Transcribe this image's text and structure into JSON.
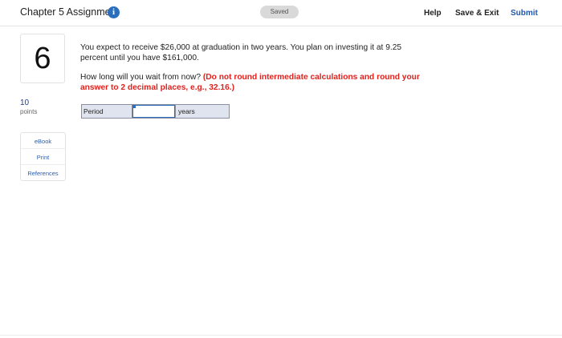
{
  "header": {
    "title": "Chapter 5 Assignment",
    "info_icon": "i",
    "saved_label": "Saved",
    "help_label": "Help",
    "save_exit_label": "Save & Exit",
    "submit_label": "Submit"
  },
  "question": {
    "number": "6",
    "points_value": "10",
    "points_label": "points",
    "text": "You expect to receive $26,000 at graduation in two years. You plan on investing it at 9.25 percent until you have $161,000.",
    "prompt": "How long will you wait from now?",
    "instruction": "(Do not round intermediate calculations and round your answer to 2 decimal places, e.g., 32.16.)"
  },
  "resources": {
    "ebook": "eBook",
    "print": "Print",
    "references": "References"
  },
  "answer": {
    "label": "Period",
    "value": "",
    "unit": "years"
  },
  "colors": {
    "accent": "#1c57b3",
    "instruction_red": "#e0211d",
    "info_blue": "#2a6ebd"
  }
}
